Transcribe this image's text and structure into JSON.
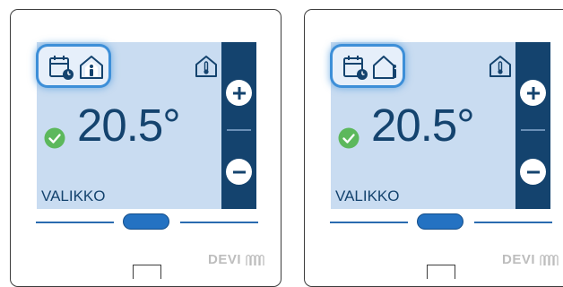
{
  "devices": [
    {
      "temperature": "20.5°",
      "menu_label": "VALIKKO",
      "brand": "DEVI",
      "home_icon_variant": "filled",
      "icons": [
        "calendar-clock-icon",
        "home-person-icon",
        "thermometer-house-icon",
        "check-circle-icon",
        "plus-icon",
        "minus-icon"
      ]
    },
    {
      "temperature": "20.5°",
      "menu_label": "VALIKKO",
      "brand": "DEVI",
      "home_icon_variant": "outline",
      "icons": [
        "calendar-clock-icon",
        "home-person-icon",
        "thermometer-house-icon",
        "check-circle-icon",
        "plus-icon",
        "minus-icon"
      ]
    }
  ],
  "colors": {
    "screen_background": "#c9dcf1",
    "sidebar": "#14436e",
    "highlight_ring": "#3d8fd8",
    "status_ok": "#5cb85c",
    "pill": "#2472c2"
  }
}
